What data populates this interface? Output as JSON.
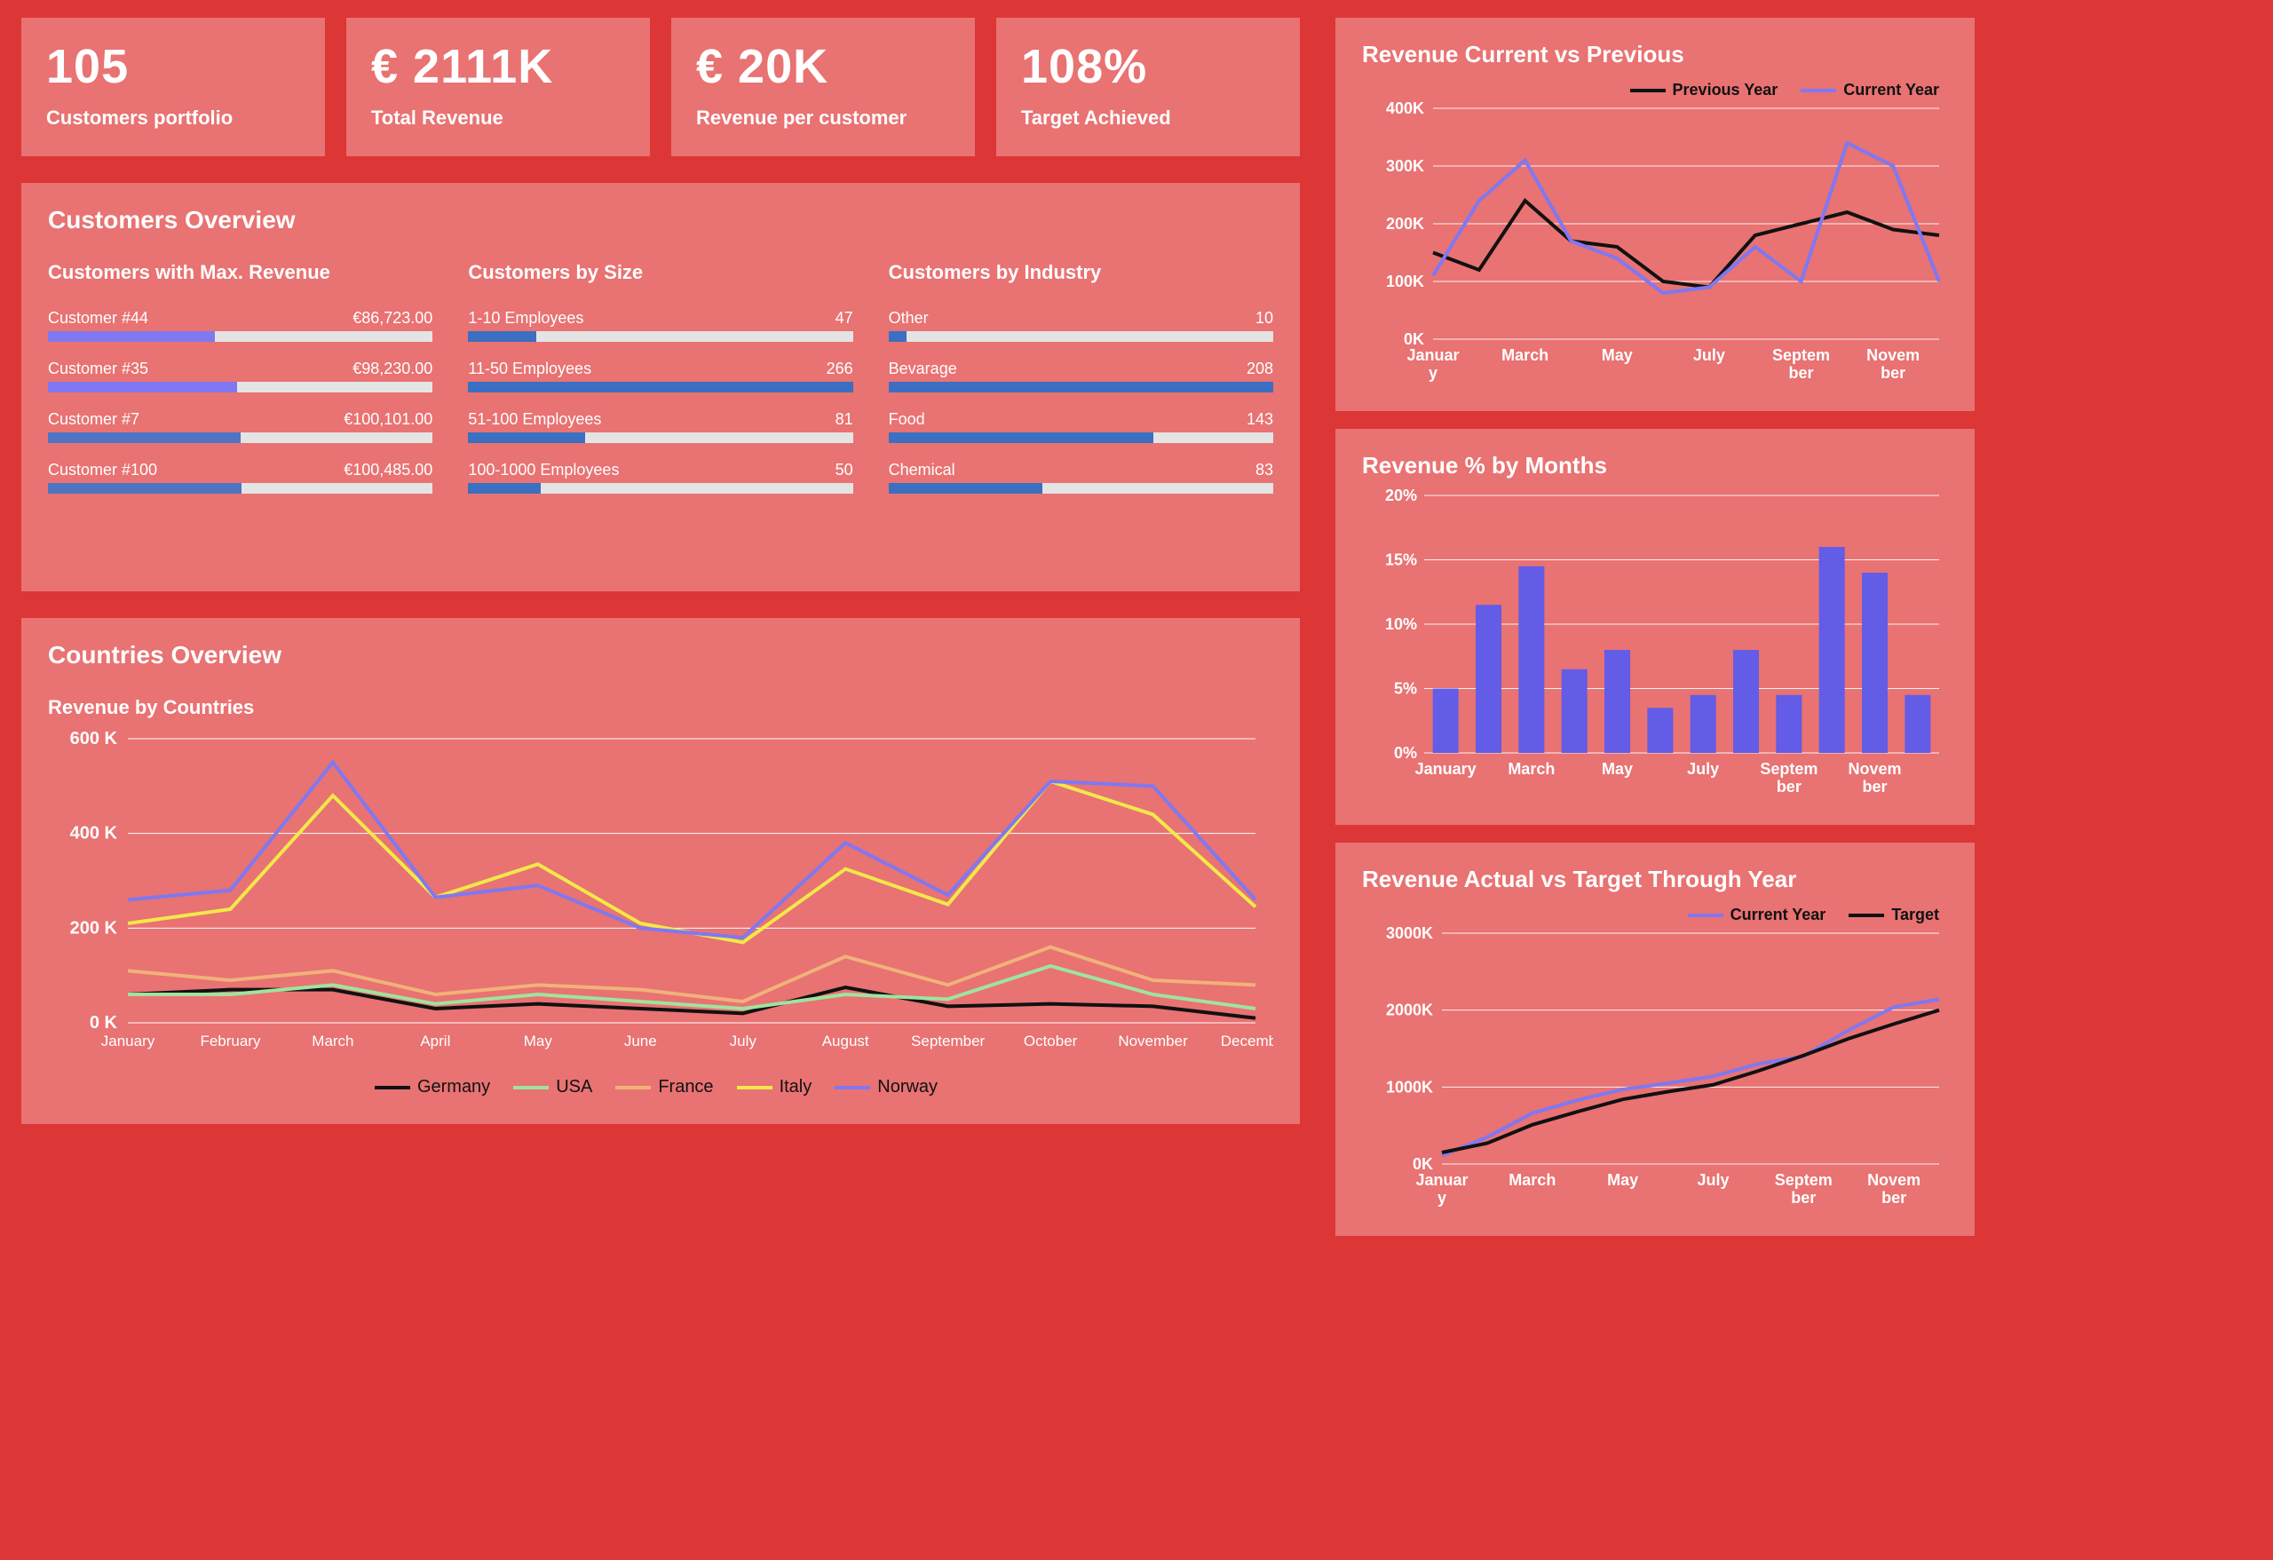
{
  "kpis": [
    {
      "value": "105",
      "label": "Customers portfolio"
    },
    {
      "value": "€ 2111K",
      "label": "Total Revenue"
    },
    {
      "value": "€ 20K",
      "label": "Revenue per customer"
    },
    {
      "value": "108%",
      "label": "Target Achieved"
    }
  ],
  "customersOverview": {
    "title": "Customers Overview",
    "maxRevenue": {
      "title": "Customers with Max. Revenue",
      "max": 100485,
      "rows": [
        {
          "name": "Customer #44",
          "valueText": "€86,723.00",
          "value": 86723,
          "color": "#7f78f1"
        },
        {
          "name": "Customer #35",
          "valueText": "€98,230.00",
          "value": 98230,
          "color": "#7f78f1"
        },
        {
          "name": "Customer #7",
          "valueText": "€100,101.00",
          "value": 100101,
          "color": "#4e74c3"
        },
        {
          "name": "Customer #100",
          "valueText": "€100,485.00",
          "value": 100485,
          "color": "#4e74c3"
        }
      ]
    },
    "bySize": {
      "title": "Customers by Size",
      "max": 266,
      "rows": [
        {
          "name": "1-10 Employees",
          "valueText": "47",
          "value": 47,
          "color": "#3b6fc1"
        },
        {
          "name": "11-50 Employees",
          "valueText": "266",
          "value": 266,
          "color": "#3b6fc1"
        },
        {
          "name": "51-100 Employees",
          "valueText": "81",
          "value": 81,
          "color": "#3b6fc1"
        },
        {
          "name": "100-1000 Employees",
          "valueText": "50",
          "value": 50,
          "color": "#3b6fc1"
        }
      ]
    },
    "byIndustry": {
      "title": "Customers by Industry",
      "max": 208,
      "rows": [
        {
          "name": "Other",
          "valueText": "10",
          "value": 10,
          "color": "#3b6fc1"
        },
        {
          "name": "Bevarage",
          "valueText": "208",
          "value": 208,
          "color": "#3b6fc1"
        },
        {
          "name": "Food",
          "valueText": "143",
          "value": 143,
          "color": "#3b6fc1"
        },
        {
          "name": "Chemical",
          "valueText": "83",
          "value": 83,
          "color": "#3b6fc1"
        }
      ]
    }
  },
  "countriesOverview": {
    "title": "Countries Overview",
    "subtitle": "Revenue by Countries"
  },
  "rightTitles": {
    "currVsPrev": "Revenue Current vs Previous",
    "pctByMonths": "Revenue % by Months",
    "actualVsTarget": "Revenue Actual vs Target Through Year"
  },
  "legends": {
    "currVsPrev": [
      "Previous Year",
      "Current Year"
    ],
    "countries": [
      "Germany",
      "USA",
      "France",
      "Italy",
      "Norway"
    ],
    "actualVsTarget": [
      "Current Year",
      "Target"
    ]
  },
  "chart_data": [
    {
      "id": "revenue_current_vs_previous",
      "type": "line",
      "title": "Revenue Current vs Previous",
      "categories": [
        "January",
        "February",
        "March",
        "April",
        "May",
        "June",
        "July",
        "August",
        "September",
        "October",
        "November",
        "December"
      ],
      "xticks_shown": [
        "January",
        "March",
        "May",
        "July",
        "September",
        "November"
      ],
      "ylabel": "",
      "ylim": [
        0,
        400000
      ],
      "series": [
        {
          "name": "Previous Year",
          "color": "#111111",
          "values": [
            150000,
            120000,
            240000,
            170000,
            160000,
            100000,
            90000,
            180000,
            200000,
            220000,
            190000,
            180000
          ]
        },
        {
          "name": "Current Year",
          "color": "#7f78f1",
          "values": [
            110000,
            240000,
            310000,
            170000,
            140000,
            80000,
            90000,
            160000,
            100000,
            340000,
            300000,
            100000
          ]
        }
      ]
    },
    {
      "id": "revenue_pct_by_months",
      "type": "bar",
      "title": "Revenue % by Months",
      "categories": [
        "January",
        "February",
        "March",
        "April",
        "May",
        "June",
        "July",
        "August",
        "September",
        "October",
        "November",
        "December"
      ],
      "xticks_shown": [
        "January",
        "March",
        "May",
        "July",
        "September",
        "November"
      ],
      "ylabel": "%",
      "ylim": [
        0,
        20
      ],
      "values": [
        5,
        11.5,
        14.5,
        6.5,
        8,
        3.5,
        4.5,
        8,
        4.5,
        16,
        14,
        4.5
      ],
      "color": "#635ce6"
    },
    {
      "id": "revenue_actual_vs_target_through_year",
      "type": "line",
      "title": "Revenue Actual vs Target Through Year",
      "categories": [
        "January",
        "February",
        "March",
        "April",
        "May",
        "June",
        "July",
        "August",
        "September",
        "October",
        "November",
        "December"
      ],
      "xticks_shown": [
        "January",
        "March",
        "May",
        "July",
        "September",
        "November"
      ],
      "ylabel": "",
      "ylim": [
        0,
        3000000
      ],
      "series": [
        {
          "name": "Current Year",
          "color": "#7f78f1",
          "values": [
            110000,
            350000,
            660000,
            830000,
            970000,
            1050000,
            1140000,
            1300000,
            1400000,
            1740000,
            2040000,
            2140000
          ]
        },
        {
          "name": "Target",
          "color": "#111111",
          "values": [
            150000,
            270000,
            510000,
            680000,
            840000,
            940000,
            1030000,
            1210000,
            1410000,
            1630000,
            1820000,
            2000000
          ]
        }
      ]
    },
    {
      "id": "revenue_by_countries",
      "type": "line",
      "title": "Revenue by Countries",
      "categories": [
        "January",
        "February",
        "March",
        "April",
        "May",
        "June",
        "July",
        "August",
        "September",
        "October",
        "November",
        "December"
      ],
      "ylabel": "K",
      "ylim": [
        0,
        600
      ],
      "series": [
        {
          "name": "Germany",
          "color": "#111111",
          "values": [
            60,
            70,
            70,
            30,
            40,
            30,
            20,
            75,
            35,
            40,
            35,
            10
          ]
        },
        {
          "name": "USA",
          "color": "#9fe39f",
          "values": [
            60,
            60,
            80,
            40,
            60,
            45,
            30,
            60,
            50,
            120,
            60,
            30
          ]
        },
        {
          "name": "France",
          "color": "#f0b27a",
          "values": [
            110,
            90,
            110,
            60,
            80,
            70,
            45,
            140,
            80,
            160,
            90,
            80
          ]
        },
        {
          "name": "Italy",
          "color": "#f2e84a",
          "values": [
            210,
            240,
            480,
            265,
            335,
            210,
            170,
            325,
            250,
            510,
            440,
            245
          ]
        },
        {
          "name": "Norway",
          "color": "#7f78f1",
          "values": [
            260,
            280,
            550,
            265,
            290,
            200,
            180,
            380,
            270,
            510,
            500,
            260
          ]
        }
      ]
    }
  ]
}
